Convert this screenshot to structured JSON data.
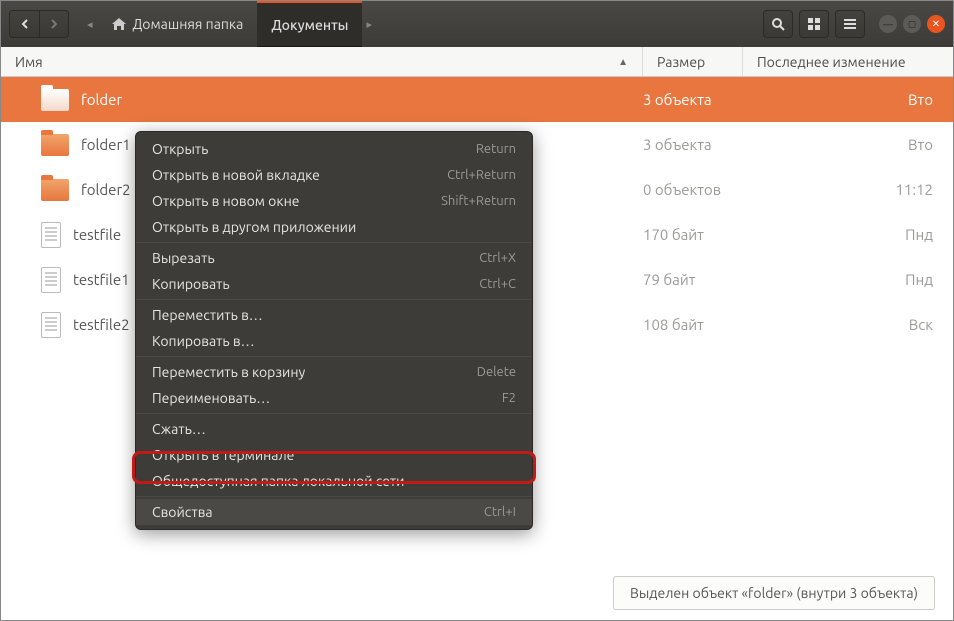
{
  "toolbar": {
    "breadcrumb": [
      {
        "label": "Домашняя папка",
        "active": false,
        "home": true
      },
      {
        "label": "Документы",
        "active": true,
        "home": false
      }
    ]
  },
  "headers": {
    "name": "Имя",
    "size": "Размер",
    "modified": "Последнее изменение"
  },
  "rows": [
    {
      "name": "folder",
      "type": "folder",
      "size": "3 объекта",
      "mod": "Вто",
      "selected": true
    },
    {
      "name": "folder1",
      "type": "folder",
      "size": "3 объекта",
      "mod": "Вто",
      "selected": false
    },
    {
      "name": "folder2",
      "type": "folder",
      "size": "0 объектов",
      "mod": "11:12",
      "selected": false
    },
    {
      "name": "testfile",
      "type": "file",
      "size": "170 байт",
      "mod": "Пнд",
      "selected": false
    },
    {
      "name": "testfile1",
      "type": "file",
      "size": "79 байт",
      "mod": "Пнд",
      "selected": false
    },
    {
      "name": "testfile2",
      "type": "file",
      "size": "108 байт",
      "mod": "Вск",
      "selected": false
    }
  ],
  "context_menu": [
    {
      "label": "Открыть",
      "shortcut": "Return",
      "type": "item"
    },
    {
      "label": "Открыть в новой вкладке",
      "shortcut": "Ctrl+Return",
      "type": "item"
    },
    {
      "label": "Открыть в новом окне",
      "shortcut": "Shift+Return",
      "type": "item"
    },
    {
      "label": "Открыть в другом приложении",
      "shortcut": "",
      "type": "item"
    },
    {
      "type": "sep"
    },
    {
      "label": "Вырезать",
      "shortcut": "Ctrl+X",
      "type": "item"
    },
    {
      "label": "Копировать",
      "shortcut": "Ctrl+C",
      "type": "item"
    },
    {
      "type": "sep"
    },
    {
      "label": "Переместить в…",
      "shortcut": "",
      "type": "item"
    },
    {
      "label": "Копировать в…",
      "shortcut": "",
      "type": "item"
    },
    {
      "type": "sep"
    },
    {
      "label": "Переместить в корзину",
      "shortcut": "Delete",
      "type": "item"
    },
    {
      "label": "Переименовать…",
      "shortcut": "F2",
      "type": "item"
    },
    {
      "type": "sep"
    },
    {
      "label": "Сжать…",
      "shortcut": "",
      "type": "item"
    },
    {
      "label": "Открыть в терминале",
      "shortcut": "",
      "type": "item"
    },
    {
      "label": "Общедоступная папка локальной сети",
      "shortcut": "",
      "type": "item"
    },
    {
      "type": "sep"
    },
    {
      "label": "Свойства",
      "shortcut": "Ctrl+I",
      "type": "item",
      "highlighted": true
    }
  ],
  "status": "Выделен объект «folder»  (внутри 3 объекта)"
}
